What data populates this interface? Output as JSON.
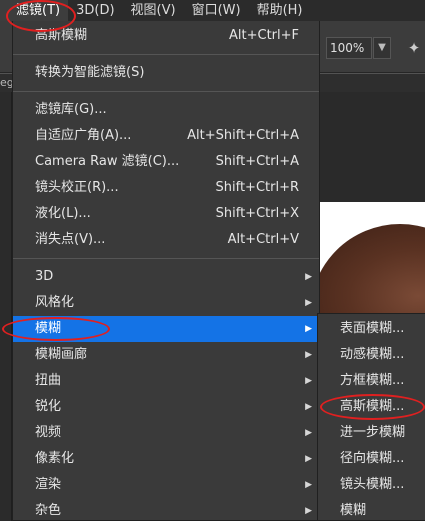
{
  "menubar": {
    "items": [
      "滤镜(T)",
      "3D(D)",
      "视图(V)",
      "窗口(W)",
      "帮助(H)"
    ]
  },
  "options_bar": {
    "zoom": "100%",
    "zoom_dropdown_icon": "chevron-down-icon"
  },
  "document_tab_fragment": "eg",
  "filter_menu": {
    "items": [
      {
        "label": "高斯模糊",
        "shortcut": "Alt+Ctrl+F"
      },
      {
        "label": "转换为智能滤镜(S)",
        "shortcut": ""
      },
      {
        "label": "滤镜库(G)...",
        "shortcut": ""
      },
      {
        "label": "自适应广角(A)...",
        "shortcut": "Alt+Shift+Ctrl+A"
      },
      {
        "label": "Camera Raw 滤镜(C)...",
        "shortcut": "Shift+Ctrl+A"
      },
      {
        "label": "镜头校正(R)...",
        "shortcut": "Shift+Ctrl+R"
      },
      {
        "label": "液化(L)...",
        "shortcut": "Shift+Ctrl+X"
      },
      {
        "label": "消失点(V)...",
        "shortcut": "Alt+Ctrl+V"
      },
      {
        "label": "3D",
        "submenu_arrow": true
      },
      {
        "label": "风格化",
        "submenu_arrow": true
      },
      {
        "label": "模糊",
        "submenu_arrow": true,
        "highlighted": true
      },
      {
        "label": "模糊画廊",
        "submenu_arrow": true
      },
      {
        "label": "扭曲",
        "submenu_arrow": true
      },
      {
        "label": "锐化",
        "submenu_arrow": true
      },
      {
        "label": "视频",
        "submenu_arrow": true
      },
      {
        "label": "像素化",
        "submenu_arrow": true
      },
      {
        "label": "渲染",
        "submenu_arrow": true
      },
      {
        "label": "杂色",
        "submenu_arrow": true
      }
    ]
  },
  "blur_submenu": {
    "items": [
      "表面模糊...",
      "动感模糊...",
      "方框模糊...",
      "高斯模糊...",
      "进一步模糊",
      "径向模糊...",
      "镜头模糊...",
      "模糊"
    ]
  },
  "annotations": {
    "color": "#e02020",
    "circled": [
      "滤镜(T)",
      "模糊",
      "高斯模糊..."
    ]
  },
  "colors": {
    "menu_bg": "#3a3a3a",
    "highlight": "#1473e6",
    "menubar_bg": "#2b2b2b"
  }
}
